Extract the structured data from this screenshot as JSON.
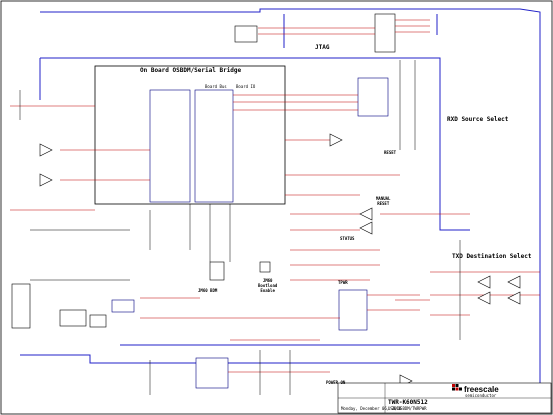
{
  "titles": {
    "bridge": "On Board OSBDM/Serial Bridge",
    "jtag": "JTAG",
    "rxd": "RXD Source Select",
    "txd": "TXD Destination Select",
    "bdm": "JM60 BDM",
    "bootloader": "JM60\nBootload\nEnable",
    "reset": "MANUAL\nRESET",
    "reset_btn": "RESET",
    "status": "STATUS",
    "tpwr": "TPWR",
    "power_on": "POWER ON",
    "bus": "Board Bus",
    "board_io": "Board IO"
  },
  "title_block": {
    "brand": "freescale",
    "tagline": "semiconductor",
    "project": "TWR-K60N512",
    "sheet": "USB/OSBDM/TWRPWR",
    "date_label": "Monday, December 06, 2010"
  },
  "colors": {
    "wire": "#c00000",
    "bus": "#2020c8",
    "outline": "#000000",
    "part": "#000080"
  }
}
